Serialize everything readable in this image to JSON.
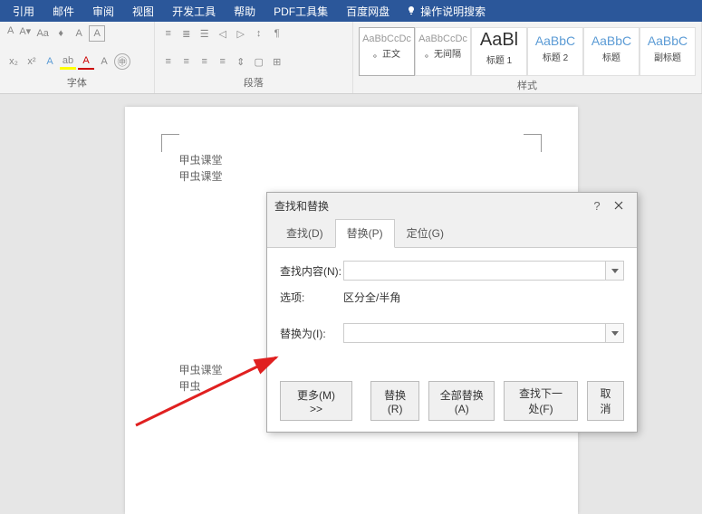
{
  "menu": {
    "items": [
      "引用",
      "邮件",
      "审阅",
      "视图",
      "开发工具",
      "帮助",
      "PDF工具集",
      "百度网盘"
    ],
    "tell_me": "操作说明搜索"
  },
  "ribbon": {
    "font_group": "字体",
    "para_group": "段落",
    "styles_group": "样式",
    "styles": [
      {
        "preview": "AaBbCcDc",
        "name": "。正文",
        "cls": ""
      },
      {
        "preview": "AaBbCcDc",
        "name": "。无间隔",
        "cls": ""
      },
      {
        "preview": "AaBl",
        "name": "标题 1",
        "cls": "big"
      },
      {
        "preview": "AaBbC",
        "name": "标题 2",
        "cls": "med"
      },
      {
        "preview": "AaBbC",
        "name": "标题",
        "cls": "med"
      },
      {
        "preview": "AaBbC",
        "name": "副标题",
        "cls": "med"
      }
    ]
  },
  "document": {
    "lines": [
      "甲虫课堂",
      "甲虫课堂",
      "甲虫课堂",
      "甲虫"
    ]
  },
  "dialog": {
    "title": "查找和替换",
    "tabs": {
      "find": "查找(D)",
      "replace": "替换(P)",
      "goto": "定位(G)"
    },
    "find_label": "查找内容(N):",
    "find_value": "",
    "options_label": "选项:",
    "options_value": "区分全/半角",
    "replace_label": "替换为(I):",
    "replace_value": "",
    "buttons": {
      "more": "更多(M) >>",
      "replace": "替换(R)",
      "replace_all": "全部替换(A)",
      "find_next": "查找下一处(F)",
      "cancel": "取消"
    }
  }
}
